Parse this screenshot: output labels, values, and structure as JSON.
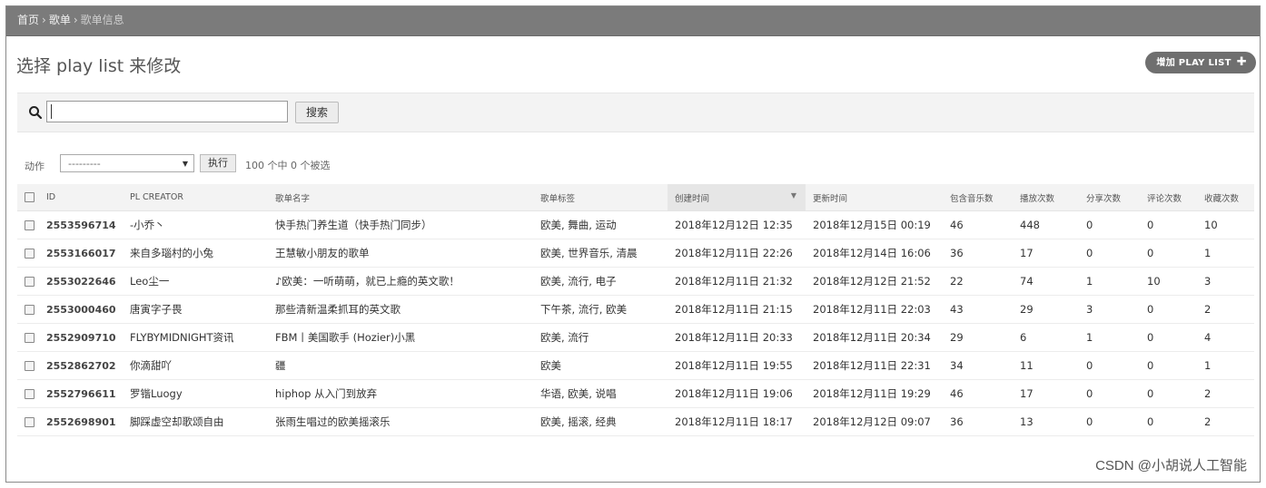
{
  "breadcrumb": {
    "home": "首页",
    "playlists": "歌单",
    "current": "歌单信息"
  },
  "page": {
    "title": "选择 play list 来修改",
    "add_button": "增加 PLAY LIST"
  },
  "search": {
    "value": "",
    "placeholder": "",
    "button": "搜索"
  },
  "actions": {
    "label": "动作",
    "selected": "---------",
    "run_button": "执行",
    "selected_counter": "100 个中 0 个被选"
  },
  "table": {
    "headers": [
      "ID",
      "PL CREATOR",
      "歌单名字",
      "歌单标签",
      "创建时间",
      "更新时间",
      "包含音乐数",
      "播放次数",
      "分享次数",
      "评论次数",
      "收藏次数"
    ],
    "sorted_column": "创建时间",
    "rows": [
      [
        "2553596714",
        "-小乔丶",
        "快手热门养生道（快手热门同步）",
        "欧美, 舞曲, 运动",
        "2018年12月12日 12:35",
        "2018年12月15日 00:19",
        "46",
        "448",
        "0",
        "0",
        "10"
      ],
      [
        "2553166017",
        "来自多瑙村的小兔",
        "王慧敏小朋友的歌单",
        "欧美, 世界音乐, 清晨",
        "2018年12月11日 22:26",
        "2018年12月14日 16:06",
        "36",
        "17",
        "0",
        "0",
        "1"
      ],
      [
        "2553022646",
        "Leo尘一",
        "♪欧美：一听萌萌，就已上瘾的英文歌！",
        "欧美, 流行, 电子",
        "2018年12月11日 21:32",
        "2018年12月12日 21:52",
        "22",
        "74",
        "1",
        "10",
        "3"
      ],
      [
        "2553000460",
        "唐寅字子畏",
        "那些清新温柔抓耳的英文歌",
        "下午茶, 流行, 欧美",
        "2018年12月11日 21:15",
        "2018年12月11日 22:03",
        "43",
        "29",
        "3",
        "0",
        "2"
      ],
      [
        "2552909710",
        "FLYBYMIDNIGHT资讯",
        "FBM丨美国歌手 (Hozier)小黑",
        "欧美, 流行",
        "2018年12月11日 20:33",
        "2018年12月11日 20:34",
        "29",
        "6",
        "1",
        "0",
        "4"
      ],
      [
        "2552862702",
        "你滴甜吖",
        "疆",
        "欧美",
        "2018年12月11日 19:55",
        "2018年12月11日 22:31",
        "34",
        "11",
        "0",
        "0",
        "1"
      ],
      [
        "2552796611",
        "罗锴Luogy",
        "hiphop 从入门到放弃",
        "华语, 欧美, 说唱",
        "2018年12月11日 19:06",
        "2018年12月11日 19:29",
        "46",
        "17",
        "0",
        "0",
        "2"
      ],
      [
        "2552698901",
        "脚踩虚空却歌颂自由",
        "张雨生唱过的欧美摇滚乐",
        "欧美, 摇滚, 经典",
        "2018年12月11日 18:17",
        "2018年12月12日 09:07",
        "36",
        "13",
        "0",
        "0",
        "2"
      ]
    ]
  },
  "watermark": "CSDN @小胡说人工智能"
}
